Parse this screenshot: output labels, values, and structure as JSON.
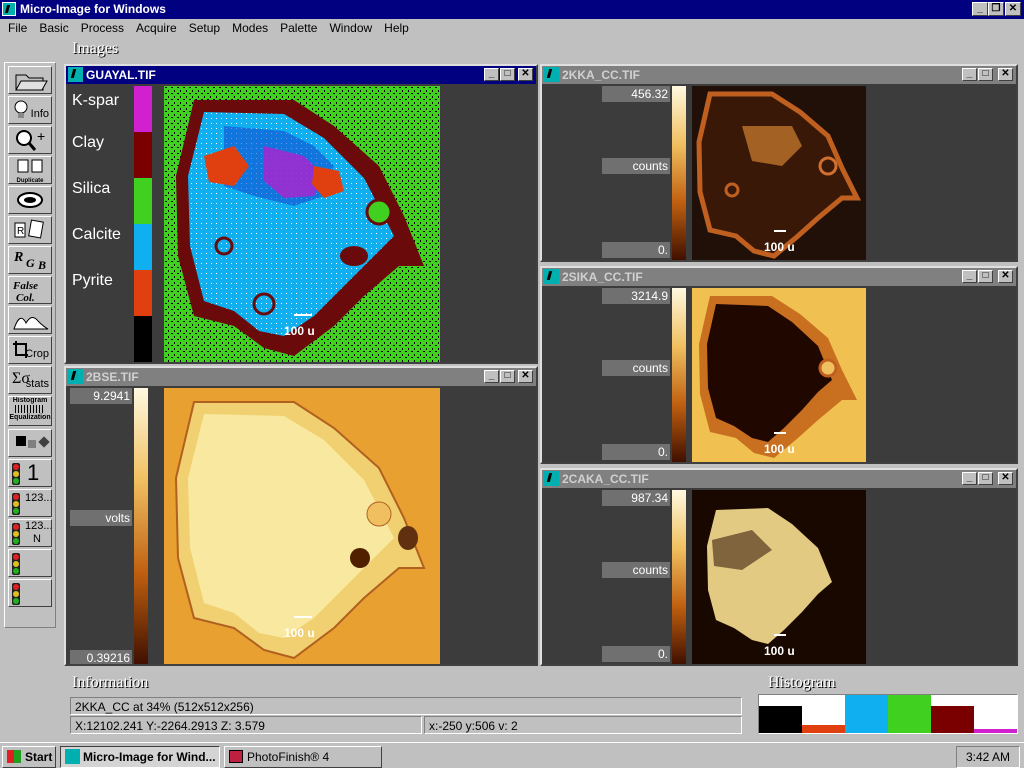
{
  "app": {
    "title": "Micro-Image for Windows"
  },
  "menu": [
    "File",
    "Basic",
    "Process",
    "Acquire",
    "Setup",
    "Modes",
    "Palette",
    "Window",
    "Help"
  ],
  "sections": {
    "images": "Images",
    "information": "Information",
    "histogram": "Histogram"
  },
  "toolbar": {
    "info": "Info",
    "duplicate": "Duplicate",
    "crop": "Crop",
    "stats": "stats",
    "histogram": "Histogram",
    "equalization": "Equalization",
    "tl1": "1",
    "tl2": "123...",
    "tl3": "123...",
    "tl3b": "N"
  },
  "windows": {
    "guayal": {
      "title": "GUAYAL.TIF",
      "legend": [
        {
          "label": "K-spar",
          "color": "#d020d0"
        },
        {
          "label": "Clay",
          "color": "#7a0000"
        },
        {
          "label": "Silica",
          "color": "#40d020"
        },
        {
          "label": "Calcite",
          "color": "#10b0f0"
        },
        {
          "label": "Pyrite",
          "color": "#e04010"
        },
        {
          "label": "",
          "color": "#000000"
        }
      ],
      "scale": "100 u"
    },
    "bse": {
      "title": "2BSE.TIF",
      "max": "9.2941",
      "unit": "volts",
      "min": "0.39216",
      "scale": "100 u"
    },
    "kka": {
      "title": "2KKA_CC.TIF",
      "max": "456.32",
      "unit": "counts",
      "min": "0.",
      "scale": "100 u"
    },
    "sika": {
      "title": "2SIKA_CC.TIF",
      "max": "3214.9",
      "unit": "counts",
      "min": "0.",
      "scale": "100 u"
    },
    "caka": {
      "title": "2CAKA_CC.TIF",
      "max": "987.34",
      "unit": "counts",
      "min": "0.",
      "scale": "100 u"
    }
  },
  "information": {
    "line1": "2KKA_CC at 34% (512x512x256)",
    "coords": "X:12102.241 Y:-2264.2913 Z: 3.579",
    "pixel": "x:-250 y:506 v:  2"
  },
  "histogram_bars": [
    {
      "color": "#000000",
      "level": 0.7
    },
    {
      "color": "#e04010",
      "level": 0.2
    },
    {
      "color": "#10b0f0",
      "level": 1.0
    },
    {
      "color": "#40d020",
      "level": 1.0
    },
    {
      "color": "#7a0000",
      "level": 0.7
    },
    {
      "color": "#d020d0",
      "level": 0.1
    }
  ],
  "taskbar": {
    "start": "Start",
    "items": [
      "Micro-Image for Wind...",
      "PhotoFinish® 4"
    ],
    "clock": "3:42 AM"
  }
}
